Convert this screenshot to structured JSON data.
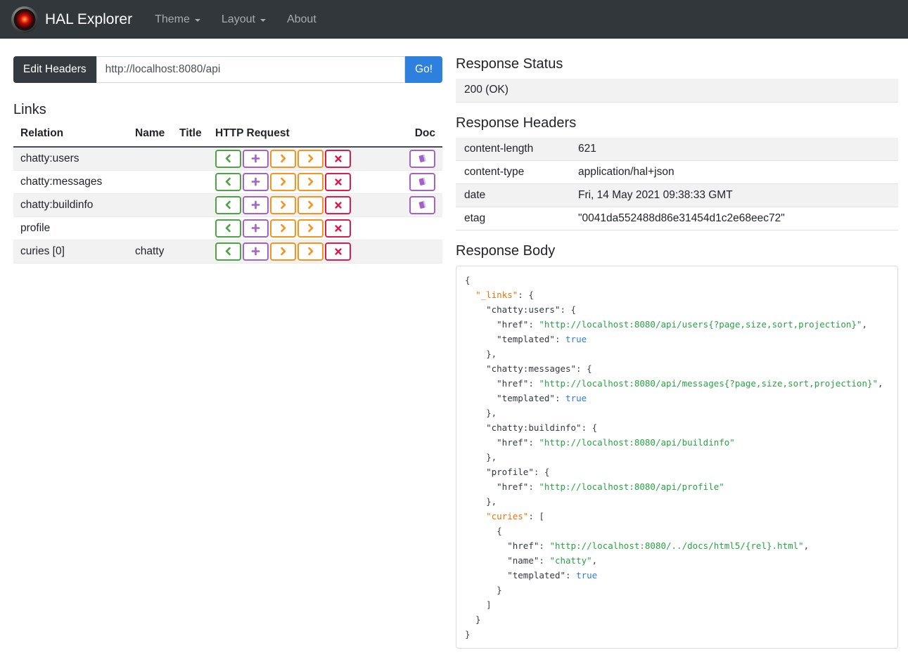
{
  "navbar": {
    "brand": "HAL Explorer",
    "items": [
      {
        "label": "Theme",
        "dropdown": true
      },
      {
        "label": "Layout",
        "dropdown": true
      },
      {
        "label": "About",
        "dropdown": false
      }
    ]
  },
  "request_bar": {
    "edit_headers_label": "Edit Headers",
    "url": "http://localhost:8080/api",
    "go_label": "Go!"
  },
  "links_section": {
    "title": "Links",
    "columns": [
      "Relation",
      "Name",
      "Title",
      "HTTP Request",
      "Doc"
    ],
    "http_methods": [
      {
        "id": "get",
        "icon": "chevron-left-icon"
      },
      {
        "id": "post",
        "icon": "plus-icon"
      },
      {
        "id": "put",
        "icon": "chevron-right-icon"
      },
      {
        "id": "patch",
        "icon": "chevron-right-icon"
      },
      {
        "id": "delete",
        "icon": "x-icon"
      }
    ],
    "rows": [
      {
        "relation": "chatty:users",
        "name": "",
        "title": "",
        "doc": true
      },
      {
        "relation": "chatty:messages",
        "name": "",
        "title": "",
        "doc": true
      },
      {
        "relation": "chatty:buildinfo",
        "name": "",
        "title": "",
        "doc": true
      },
      {
        "relation": "profile",
        "name": "",
        "title": "",
        "doc": false
      },
      {
        "relation": "curies [0]",
        "name": "chatty",
        "title": "",
        "doc": false
      }
    ]
  },
  "response_status": {
    "title": "Response Status",
    "value": "200 (OK)"
  },
  "response_headers": {
    "title": "Response Headers",
    "rows": [
      [
        "content-length",
        "621"
      ],
      [
        "content-type",
        "application/hal+json"
      ],
      [
        "date",
        "Fri, 14 May 2021 09:38:33 GMT"
      ],
      [
        "etag",
        "\"0041da552488d86e31454d1c2e68eec72\""
      ]
    ]
  },
  "response_body": {
    "title": "Response Body",
    "lines": [
      [
        [
          "p",
          "{"
        ]
      ],
      [
        [
          "p",
          "  "
        ],
        [
          "sk",
          "\"_links\""
        ],
        [
          "p",
          ": {"
        ]
      ],
      [
        [
          "p",
          "    "
        ],
        [
          "k",
          "\"chatty:users\""
        ],
        [
          "p",
          ": {"
        ]
      ],
      [
        [
          "p",
          "      "
        ],
        [
          "k",
          "\"href\""
        ],
        [
          "p",
          ": "
        ],
        [
          "s",
          "\"http://localhost:8080/api/users{?page,size,sort,projection}\""
        ],
        [
          "p",
          ","
        ]
      ],
      [
        [
          "p",
          "      "
        ],
        [
          "k",
          "\"templated\""
        ],
        [
          "p",
          ": "
        ],
        [
          "b",
          "true"
        ]
      ],
      [
        [
          "p",
          "    },"
        ]
      ],
      [
        [
          "p",
          "    "
        ],
        [
          "k",
          "\"chatty:messages\""
        ],
        [
          "p",
          ": {"
        ]
      ],
      [
        [
          "p",
          "      "
        ],
        [
          "k",
          "\"href\""
        ],
        [
          "p",
          ": "
        ],
        [
          "s",
          "\"http://localhost:8080/api/messages{?page,size,sort,projection}\""
        ],
        [
          "p",
          ","
        ]
      ],
      [
        [
          "p",
          "      "
        ],
        [
          "k",
          "\"templated\""
        ],
        [
          "p",
          ": "
        ],
        [
          "b",
          "true"
        ]
      ],
      [
        [
          "p",
          "    },"
        ]
      ],
      [
        [
          "p",
          "    "
        ],
        [
          "k",
          "\"chatty:buildinfo\""
        ],
        [
          "p",
          ": {"
        ]
      ],
      [
        [
          "p",
          "      "
        ],
        [
          "k",
          "\"href\""
        ],
        [
          "p",
          ": "
        ],
        [
          "s",
          "\"http://localhost:8080/api/buildinfo\""
        ]
      ],
      [
        [
          "p",
          "    },"
        ]
      ],
      [
        [
          "p",
          "    "
        ],
        [
          "k",
          "\"profile\""
        ],
        [
          "p",
          ": {"
        ]
      ],
      [
        [
          "p",
          "      "
        ],
        [
          "k",
          "\"href\""
        ],
        [
          "p",
          ": "
        ],
        [
          "s",
          "\"http://localhost:8080/api/profile\""
        ]
      ],
      [
        [
          "p",
          "    },"
        ]
      ],
      [
        [
          "p",
          "    "
        ],
        [
          "sk",
          "\"curies\""
        ],
        [
          "p",
          ": ["
        ]
      ],
      [
        [
          "p",
          "      {"
        ]
      ],
      [
        [
          "p",
          "        "
        ],
        [
          "k",
          "\"href\""
        ],
        [
          "p",
          ": "
        ],
        [
          "s",
          "\"http://localhost:8080/../docs/html5/{rel}.html\""
        ],
        [
          "p",
          ","
        ]
      ],
      [
        [
          "p",
          "        "
        ],
        [
          "k",
          "\"name\""
        ],
        [
          "p",
          ": "
        ],
        [
          "s",
          "\"chatty\""
        ],
        [
          "p",
          ","
        ]
      ],
      [
        [
          "p",
          "        "
        ],
        [
          "k",
          "\"templated\""
        ],
        [
          "p",
          ": "
        ],
        [
          "b",
          "true"
        ]
      ],
      [
        [
          "p",
          "      }"
        ]
      ],
      [
        [
          "p",
          "    ]"
        ]
      ],
      [
        [
          "p",
          "  }"
        ]
      ],
      [
        [
          "p",
          "}"
        ]
      ]
    ]
  },
  "colors": {
    "get": "#4aa542",
    "post": "#a263c9",
    "put": "#f7941d",
    "patch": "#f7941d",
    "delete": "#dc1b4e",
    "doc": "#a263c9",
    "go_button": "#2e80de",
    "navbar_bg": "#32373c",
    "json_special_key": "#e8740c",
    "json_string": "#27a343",
    "json_boolean": "#2f7ed3"
  }
}
